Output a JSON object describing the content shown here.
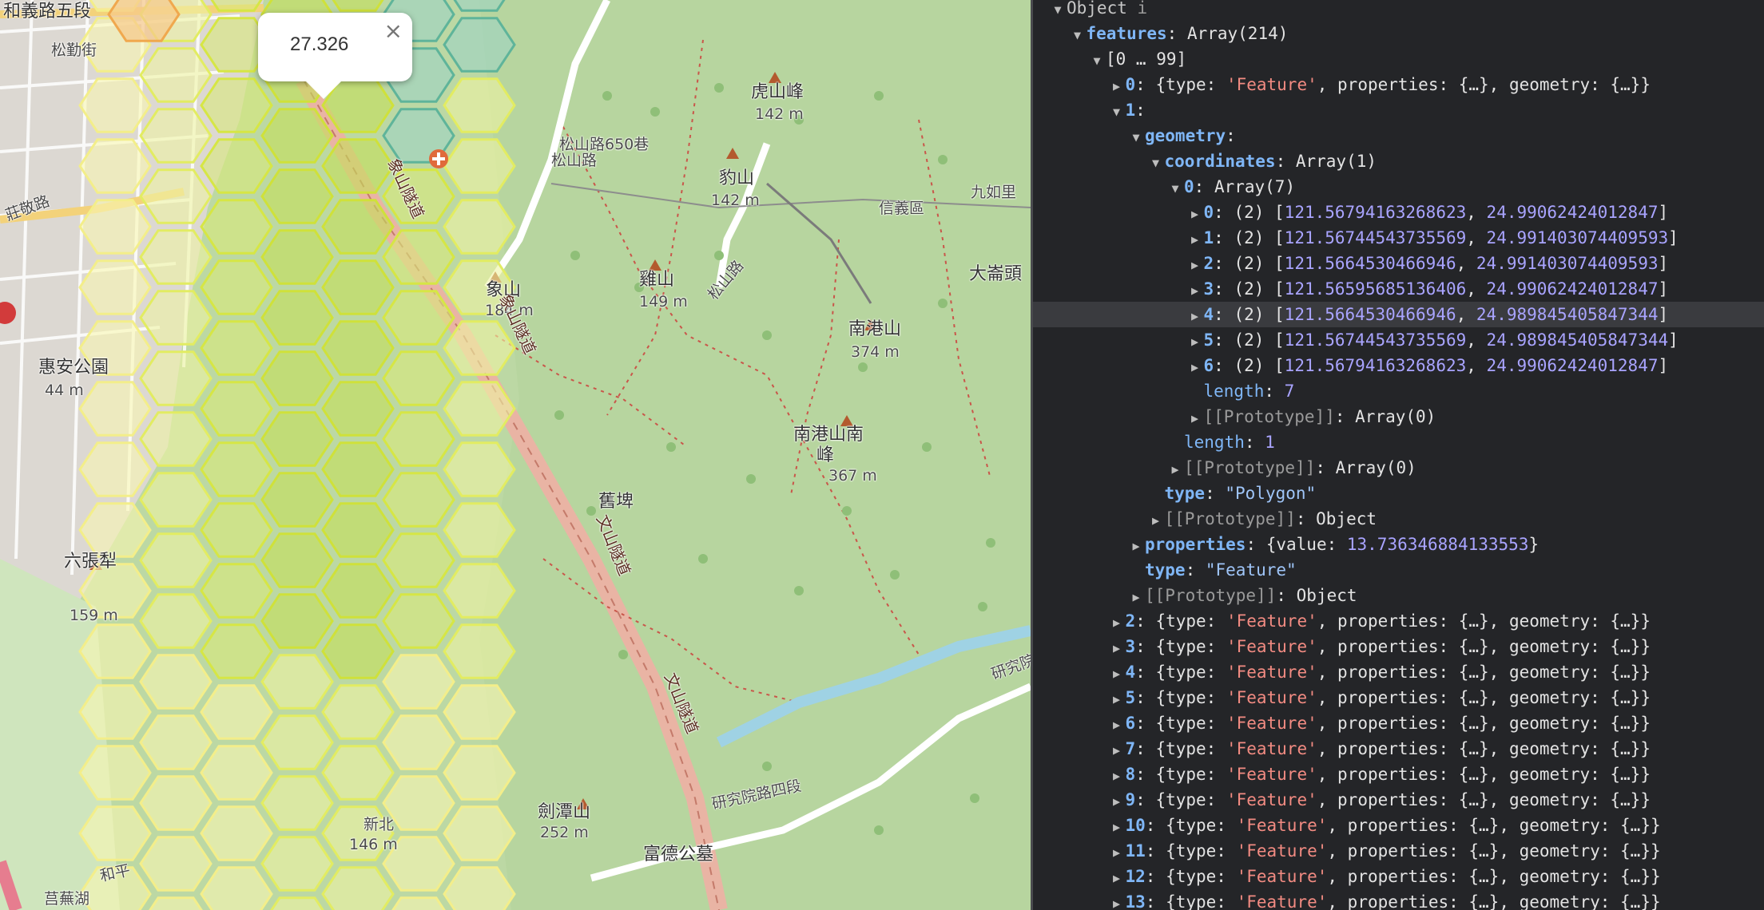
{
  "map": {
    "popup": {
      "value": "27.326",
      "close": "×"
    },
    "labels": [
      {
        "text": "和義路五段",
        "cls": "big"
      },
      {
        "text": "松勤街",
        "cls": ""
      },
      {
        "text": "松山路650巷",
        "cls": ""
      },
      {
        "text": "松山路",
        "cls": ""
      },
      {
        "text": "虎山峰",
        "cls": "big"
      },
      {
        "text": "142 m",
        "cls": ""
      },
      {
        "text": "豹山",
        "cls": "big"
      },
      {
        "text": "142 m",
        "cls": ""
      },
      {
        "text": "九如里",
        "cls": ""
      },
      {
        "text": "信義區",
        "cls": ""
      },
      {
        "text": "大崙頭",
        "cls": "big"
      },
      {
        "text": "象山",
        "cls": "big"
      },
      {
        "text": "184 m",
        "cls": ""
      },
      {
        "text": "象山隧道",
        "cls": "road"
      },
      {
        "text": "象山隧道",
        "cls": "road"
      },
      {
        "text": "雞山",
        "cls": "big"
      },
      {
        "text": "149 m",
        "cls": ""
      },
      {
        "text": "松山路",
        "cls": ""
      },
      {
        "text": "南港山",
        "cls": "big"
      },
      {
        "text": "374 m",
        "cls": ""
      },
      {
        "text": "南港山南",
        "cls": "big"
      },
      {
        "text": "峰",
        "cls": "big"
      },
      {
        "text": "367 m",
        "cls": ""
      },
      {
        "text": "舊埤",
        "cls": "big"
      },
      {
        "text": "文山隧道",
        "cls": "road"
      },
      {
        "text": "文山隧道",
        "cls": "road"
      },
      {
        "text": "惠安公園",
        "cls": "big"
      },
      {
        "text": "44 m",
        "cls": ""
      },
      {
        "text": "莊敬路",
        "cls": ""
      },
      {
        "text": "六張犁",
        "cls": "big"
      },
      {
        "text": "159 m",
        "cls": ""
      },
      {
        "text": "劍潭山",
        "cls": "big"
      },
      {
        "text": "252 m",
        "cls": ""
      },
      {
        "text": "富德公墓",
        "cls": "big"
      },
      {
        "text": "研究院路四段",
        "cls": ""
      },
      {
        "text": "研究院",
        "cls": ""
      },
      {
        "text": "新北",
        "cls": ""
      },
      {
        "text": "146 m",
        "cls": ""
      },
      {
        "text": "莒蕪湖",
        "cls": ""
      },
      {
        "text": "和平",
        "cls": ""
      }
    ]
  },
  "console": {
    "rows": [
      {
        "indent": 0,
        "tri": "down",
        "parts": [
          [
            "grey",
            "Object "
          ],
          [
            "muted",
            "i"
          ]
        ]
      },
      {
        "indent": 1,
        "tri": "down",
        "parts": [
          [
            "key b",
            "features"
          ],
          [
            "white",
            ": Array(214)"
          ]
        ]
      },
      {
        "indent": 2,
        "tri": "down",
        "parts": [
          [
            "white",
            "[0 … 99]"
          ]
        ]
      },
      {
        "indent": 3,
        "tri": "right",
        "parts": [
          [
            "key b",
            "0"
          ],
          [
            "white",
            ": {type: "
          ],
          [
            "str",
            "'Feature'"
          ],
          [
            "white",
            ", properties: {…}, geometry: {…}}"
          ]
        ]
      },
      {
        "indent": 3,
        "tri": "down",
        "parts": [
          [
            "key b",
            "1"
          ],
          [
            "white",
            ":"
          ]
        ]
      },
      {
        "indent": 4,
        "tri": "down",
        "parts": [
          [
            "key b",
            "geometry"
          ],
          [
            "white",
            ":"
          ]
        ]
      },
      {
        "indent": 5,
        "tri": "down",
        "parts": [
          [
            "key b",
            "coordinates"
          ],
          [
            "white",
            ": Array(1)"
          ]
        ]
      },
      {
        "indent": 6,
        "tri": "down",
        "parts": [
          [
            "key b",
            "0"
          ],
          [
            "white",
            ": Array(7)"
          ]
        ]
      },
      {
        "indent": 7,
        "tri": "right",
        "parts": [
          [
            "key b",
            "0"
          ],
          [
            "white",
            ": (2) ["
          ],
          [
            "num",
            "121.56794163268623"
          ],
          [
            "white",
            ", "
          ],
          [
            "num",
            "24.99062424012847"
          ],
          [
            "white",
            "]"
          ]
        ]
      },
      {
        "indent": 7,
        "tri": "right",
        "parts": [
          [
            "key b",
            "1"
          ],
          [
            "white",
            ": (2) ["
          ],
          [
            "num",
            "121.56744543735569"
          ],
          [
            "white",
            ", "
          ],
          [
            "num",
            "24.991403074409593"
          ],
          [
            "white",
            "]"
          ]
        ]
      },
      {
        "indent": 7,
        "tri": "right",
        "parts": [
          [
            "key b",
            "2"
          ],
          [
            "white",
            ": (2) ["
          ],
          [
            "num",
            "121.5664530466946"
          ],
          [
            "white",
            ", "
          ],
          [
            "num",
            "24.991403074409593"
          ],
          [
            "white",
            "]"
          ]
        ]
      },
      {
        "indent": 7,
        "tri": "right",
        "parts": [
          [
            "key b",
            "3"
          ],
          [
            "white",
            ": (2) ["
          ],
          [
            "num",
            "121.56595685136406"
          ],
          [
            "white",
            ", "
          ],
          [
            "num",
            "24.99062424012847"
          ],
          [
            "white",
            "]"
          ]
        ]
      },
      {
        "indent": 7,
        "tri": "right",
        "hl": true,
        "parts": [
          [
            "key b",
            "4"
          ],
          [
            "white",
            ": (2) ["
          ],
          [
            "num",
            "121.5664530466946"
          ],
          [
            "white",
            ", "
          ],
          [
            "num",
            "24.989845405847344"
          ],
          [
            "white",
            "]"
          ]
        ]
      },
      {
        "indent": 7,
        "tri": "right",
        "parts": [
          [
            "key b",
            "5"
          ],
          [
            "white",
            ": (2) ["
          ],
          [
            "num",
            "121.56744543735569"
          ],
          [
            "white",
            ", "
          ],
          [
            "num",
            "24.989845405847344"
          ],
          [
            "white",
            "]"
          ]
        ]
      },
      {
        "indent": 7,
        "tri": "right",
        "parts": [
          [
            "key b",
            "6"
          ],
          [
            "white",
            ": (2) ["
          ],
          [
            "num",
            "121.56794163268623"
          ],
          [
            "white",
            ", "
          ],
          [
            "num",
            "24.99062424012847"
          ],
          [
            "white",
            "]"
          ]
        ]
      },
      {
        "indent": 7,
        "tri": "none",
        "parts": [
          [
            "key",
            "length"
          ],
          [
            "white",
            ": "
          ],
          [
            "num",
            "7"
          ]
        ]
      },
      {
        "indent": 7,
        "tri": "right",
        "parts": [
          [
            "muted",
            "[[Prototype]]"
          ],
          [
            "white",
            ": Array(0)"
          ]
        ]
      },
      {
        "indent": 6,
        "tri": "none",
        "parts": [
          [
            "key",
            "length"
          ],
          [
            "white",
            ": "
          ],
          [
            "num",
            "1"
          ]
        ]
      },
      {
        "indent": 6,
        "tri": "right",
        "parts": [
          [
            "muted",
            "[[Prototype]]"
          ],
          [
            "white",
            ": Array(0)"
          ]
        ]
      },
      {
        "indent": 5,
        "tri": "none",
        "parts": [
          [
            "key b",
            "type"
          ],
          [
            "white",
            ": "
          ],
          [
            "strb",
            "\"Polygon\""
          ]
        ]
      },
      {
        "indent": 5,
        "tri": "right",
        "parts": [
          [
            "muted",
            "[[Prototype]]"
          ],
          [
            "white",
            ": Object"
          ]
        ]
      },
      {
        "indent": 4,
        "tri": "right",
        "parts": [
          [
            "key b",
            "properties"
          ],
          [
            "white",
            ": {value: "
          ],
          [
            "num",
            "13.736346884133553"
          ],
          [
            "white",
            "}"
          ]
        ]
      },
      {
        "indent": 4,
        "tri": "none",
        "parts": [
          [
            "key b",
            "type"
          ],
          [
            "white",
            ": "
          ],
          [
            "strb",
            "\"Feature\""
          ]
        ]
      },
      {
        "indent": 4,
        "tri": "right",
        "parts": [
          [
            "muted",
            "[[Prototype]]"
          ],
          [
            "white",
            ": Object"
          ]
        ]
      },
      {
        "indent": 3,
        "tri": "right",
        "parts": [
          [
            "key b",
            "2"
          ],
          [
            "white",
            ": {type: "
          ],
          [
            "str",
            "'Feature'"
          ],
          [
            "white",
            ", properties: {…}, geometry: {…}}"
          ]
        ]
      },
      {
        "indent": 3,
        "tri": "right",
        "parts": [
          [
            "key b",
            "3"
          ],
          [
            "white",
            ": {type: "
          ],
          [
            "str",
            "'Feature'"
          ],
          [
            "white",
            ", properties: {…}, geometry: {…}}"
          ]
        ]
      },
      {
        "indent": 3,
        "tri": "right",
        "parts": [
          [
            "key b",
            "4"
          ],
          [
            "white",
            ": {type: "
          ],
          [
            "str",
            "'Feature'"
          ],
          [
            "white",
            ", properties: {…}, geometry: {…}}"
          ]
        ]
      },
      {
        "indent": 3,
        "tri": "right",
        "parts": [
          [
            "key b",
            "5"
          ],
          [
            "white",
            ": {type: "
          ],
          [
            "str",
            "'Feature'"
          ],
          [
            "white",
            ", properties: {…}, geometry: {…}}"
          ]
        ]
      },
      {
        "indent": 3,
        "tri": "right",
        "parts": [
          [
            "key b",
            "6"
          ],
          [
            "white",
            ": {type: "
          ],
          [
            "str",
            "'Feature'"
          ],
          [
            "white",
            ", properties: {…}, geometry: {…}}"
          ]
        ]
      },
      {
        "indent": 3,
        "tri": "right",
        "parts": [
          [
            "key b",
            "7"
          ],
          [
            "white",
            ": {type: "
          ],
          [
            "str",
            "'Feature'"
          ],
          [
            "white",
            ", properties: {…}, geometry: {…}}"
          ]
        ]
      },
      {
        "indent": 3,
        "tri": "right",
        "parts": [
          [
            "key b",
            "8"
          ],
          [
            "white",
            ": {type: "
          ],
          [
            "str",
            "'Feature'"
          ],
          [
            "white",
            ", properties: {…}, geometry: {…}}"
          ]
        ]
      },
      {
        "indent": 3,
        "tri": "right",
        "parts": [
          [
            "key b",
            "9"
          ],
          [
            "white",
            ": {type: "
          ],
          [
            "str",
            "'Feature'"
          ],
          [
            "white",
            ", properties: {…}, geometry: {…}}"
          ]
        ]
      },
      {
        "indent": 3,
        "tri": "right",
        "parts": [
          [
            "key b",
            "10"
          ],
          [
            "white",
            ": {type: "
          ],
          [
            "str",
            "'Feature'"
          ],
          [
            "white",
            ", properties: {…}, geometry: {…}}"
          ]
        ]
      },
      {
        "indent": 3,
        "tri": "right",
        "parts": [
          [
            "key b",
            "11"
          ],
          [
            "white",
            ": {type: "
          ],
          [
            "str",
            "'Feature'"
          ],
          [
            "white",
            ", properties: {…}, geometry: {…}}"
          ]
        ]
      },
      {
        "indent": 3,
        "tri": "right",
        "parts": [
          [
            "key b",
            "12"
          ],
          [
            "white",
            ": {type: "
          ],
          [
            "str",
            "'Feature'"
          ],
          [
            "white",
            ", properties: {…}, geometry: {…}}"
          ]
        ]
      },
      {
        "indent": 3,
        "tri": "right",
        "parts": [
          [
            "key b",
            "13"
          ],
          [
            "white",
            ": {type: "
          ],
          [
            "str",
            "'Feature'"
          ],
          [
            "white",
            ", properties: {…}, geometry: {…}}"
          ]
        ]
      }
    ]
  }
}
